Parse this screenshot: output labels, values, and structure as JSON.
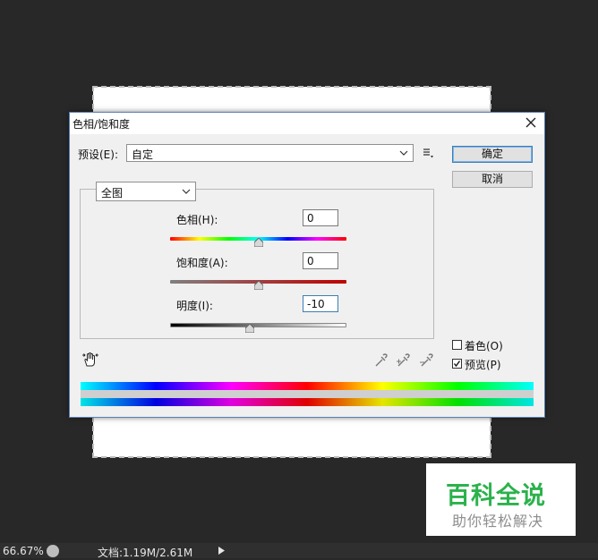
{
  "dialog": {
    "title": "色相/饱和度",
    "preset_label": "预设(E):",
    "preset_value": "自定",
    "ok_label": "确定",
    "cancel_label": "取消",
    "channel_value": "全图",
    "hue_label": "色相(H):",
    "hue_value": "0",
    "saturation_label": "饱和度(A):",
    "saturation_value": "0",
    "lightness_label": "明度(I):",
    "lightness_value": "-10",
    "colorize_label": "着色(O)",
    "colorize_checked": false,
    "preview_label": "预览(P)",
    "preview_checked": true
  },
  "statusbar": {
    "zoom": "66.67%",
    "doc_info": "文档:1.19M/2.61M"
  },
  "watermark": {
    "main": "百科全说",
    "sub": "助你轻松解决"
  },
  "icons": [
    "close-icon",
    "chevron-down-icon",
    "preset-options-icon",
    "hand-adjust-icon",
    "eyedropper-icon",
    "eyedropper-plus-icon",
    "eyedropper-minus-icon",
    "checkmark-icon",
    "play-arrow-icon"
  ]
}
